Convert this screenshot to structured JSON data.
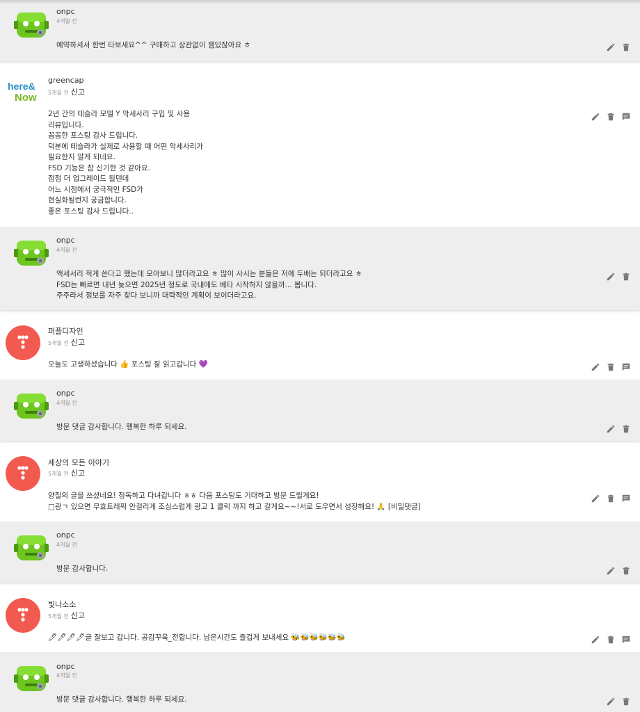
{
  "comments": [
    {
      "id": "r0",
      "author": "onpc",
      "time": "4개월 전",
      "text": "예약하셔서 한번 타보세요^^ 구매하고 상관없이 잼있잖아요 ㅎ"
    },
    {
      "id": "c1",
      "author": "greencap",
      "time": "5개월 전",
      "report": "신고",
      "text": "2년 간의 테슬라 모델 Y 악세사리 구입 및 사용\n리뷰입니다.\n꼼꼼한 포스팅 감사 드립니다.\n덕분에 테슬라가 실제로 사용할 때 어떤 악세사리가\n필요한지 알게 되네요.\nFSD 기능은 참 신기한 것 같아요.\n점점 더 업그레이드 될텐데\n어느 시점에서 궁극적인 FSD가\n현실화될런지 궁금합니다.\n좋은 포스팅 감사 드립니다.."
    },
    {
      "id": "r1",
      "author": "onpc",
      "time": "4개월 전",
      "text": "액세서리 적게 쓴다고 했는데 모아보니 많더라고요 ㅎ 많이 사시는 분들은 저에 두배는 되더라고요 ㅎ\nFSD는 빠르면 내년 늦으면 2025년 정도로 국내에도 베타 시작하지 않을까... 봅니다.\n주주라서 정보를 자주 찾다 보니까 대략적인 계획이 보이더라고요."
    },
    {
      "id": "c2",
      "author": "퍼플디자인",
      "time": "5개월 전",
      "report": "신고",
      "text": "오늘도 고생하셨습니다 👍 포스팅 잘 읽고갑니다 💜"
    },
    {
      "id": "r2",
      "author": "onpc",
      "time": "4개월 전",
      "text": "방문 댓글 감사합니다. 행복한 하루 되세요."
    },
    {
      "id": "c3",
      "author": "세상의 모든 이야기",
      "time": "5개월 전",
      "report": "신고",
      "text": "양질의 글을 쓰셨네요! 정독하고 다녀갑니다 ㅎㅎ 다음 포스팅도 기대하고 방문 드릴게요!\n□광ㄱ 있으면 무효트레픽 안걸리게 조심스럽게 광고 1 클릭 까지 하고 갈게요~~!서로 도우면서 성장해요! 🙏 [비밀댓글]"
    },
    {
      "id": "r3",
      "author": "onpc",
      "time": "4개월 전",
      "text": "방문 감사합니다."
    },
    {
      "id": "c4",
      "author": "빛나소소",
      "time": "5개월 전",
      "report": "신고",
      "text": "🖊🖊🖊🖊글 잘보고 갑니다. 공감꾸욱_전합니다. 남은시간도 즐겁게 보내세요 🐝🐝🐝🐝🐝🐝"
    },
    {
      "id": "r4",
      "author": "onpc",
      "time": "4개월 전",
      "text": "방문 댓글 감사합니다. 행복한 하루 되세요."
    }
  ],
  "avatars": {
    "onpc": "green-robot-avatar",
    "greencap": "here-and-now-logo",
    "default": "pink-dots-avatar"
  },
  "logo_text": {
    "line1": "here&",
    "line2": "Now"
  },
  "colors": {
    "reply_bg": "#eeeeee",
    "robot_green": "#6cc61e",
    "pink": "#f25a50",
    "icon": "#777777"
  }
}
